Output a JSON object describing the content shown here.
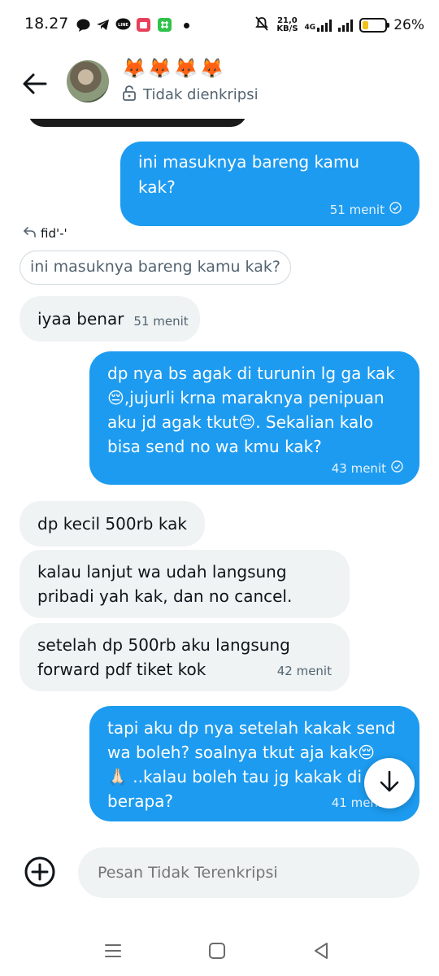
{
  "status_bar": {
    "time": "18.27",
    "net_speed_value": "21,0",
    "net_speed_unit": "KB/S",
    "network_type": "4G",
    "battery_percent": "26%",
    "battery_level": 0.26,
    "colors": {
      "battery": "#f2c21c"
    }
  },
  "header": {
    "contact_name": "🦊🦊🦊🦊",
    "encryption_status": "Tidak dienkripsi"
  },
  "messages": [
    {
      "direction": "out",
      "lines": [
        "ini masuknya bareng kamu kak?"
      ],
      "time": "51 menit"
    },
    {
      "direction": "in",
      "reply_to_name": "fid'-'",
      "quoted_text": "ini masuknya bareng kamu kak?",
      "lines": [
        "iyaa benar"
      ],
      "time": "51 menit"
    },
    {
      "direction": "out",
      "lines": [
        "dp nya bs agak di turunin lg ga kak",
        "😔,jujurli krna maraknya penipuan",
        "aku jd agak tkut😔. Sekalian kalo",
        "bisa send no wa kmu kak?"
      ],
      "time": "43 menit"
    },
    {
      "direction": "in",
      "lines": [
        "dp kecil 500rb kak"
      ],
      "time": ""
    },
    {
      "direction": "in",
      "lines": [
        "kalau lanjut wa udah langsung",
        "pribadi yah kak, dan no cancel."
      ],
      "time": ""
    },
    {
      "direction": "in",
      "lines": [
        "setelah dp 500rb aku langsung",
        "forward pdf tiket kok"
      ],
      "time": "42 menit"
    },
    {
      "direction": "out",
      "lines": [
        "tapi aku dp nya setelah kakak send",
        "wa boleh? soalnya tkut aja kak😔",
        "🙏🏻 ..kalau boleh tau jg kakak di d",
        "berapa?"
      ],
      "time": "41 menit"
    }
  ],
  "composer": {
    "placeholder": "Pesan Tidak Terenkripsi"
  },
  "colors": {
    "outgoing_bubble": "#1d9bf0",
    "incoming_bubble": "#eff3f4",
    "secondary_text": "#536471"
  },
  "icons": [
    "back-arrow-icon",
    "lock-open-icon",
    "reply-icon",
    "sent-check-icon",
    "arrow-down-icon",
    "add-circle-icon",
    "nav-recents-icon",
    "nav-home-icon",
    "nav-back-icon"
  ]
}
